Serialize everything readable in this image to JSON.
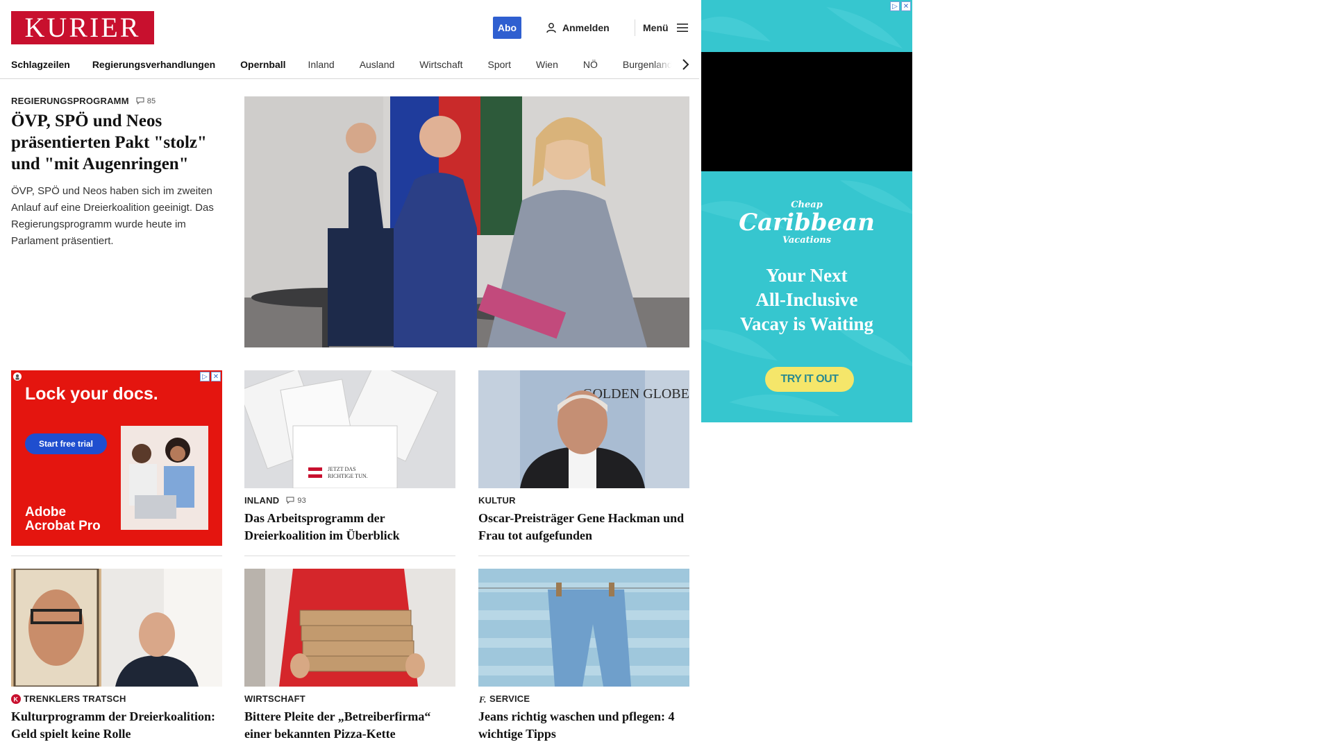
{
  "header": {
    "logo": "KURIER",
    "abo_label": "Abo",
    "login_label": "Anmelden",
    "menu_label": "Menü"
  },
  "nav": {
    "items": [
      "Schlagzeilen",
      "Regierungsverhandlungen",
      "Opernball",
      "Inland",
      "Ausland",
      "Wirtschaft",
      "Sport",
      "Wien",
      "NÖ",
      "Burgenland"
    ]
  },
  "lead": {
    "kicker": "REGIERUNGSPROGRAMM",
    "comments": "85",
    "title": "ÖVP, SPÖ und Neos präsentierten Pakt \"stolz\" und \"mit Augenringen\"",
    "teaser": "ÖVP, SPÖ und Neos haben sich im zweiten Anlauf auf eine Dreierkoalition geeinigt. Das Regierungsprogramm wurde heute im Parlament präsentiert."
  },
  "ad_left": {
    "title": "Lock your docs.",
    "cta": "Start free trial",
    "brand_line1": "Adobe",
    "brand_line2": "Acrobat Pro"
  },
  "cards": [
    {
      "kicker": "INLAND",
      "comments": "93",
      "title": "Das Arbeitsprogramm der Dreierkoalition im Überblick",
      "image_text_line1": "JETZT DAS",
      "image_text_line2": "RICHTIGE TUN."
    },
    {
      "kicker": "KULTUR",
      "title": "Oscar-Preisträger Gene Hackman und Frau tot aufgefunden",
      "image_text": "GOLDEN GLOBE"
    },
    {
      "kicker": "TRENKLERS TRATSCH",
      "title": "Kulturprogramm der Dreierkoalition: Geld spielt keine Rolle"
    },
    {
      "kicker": "WIRTSCHAFT",
      "title": "Bittere Pleite der „Betreiberfirma“ einer bekannten Pizza-Kette"
    },
    {
      "kicker": "SERVICE",
      "title": "Jeans richtig waschen und pflegen: 4 wichtige Tipps"
    }
  ],
  "ad_right": {
    "brand_top": "Cheap",
    "brand_main": "Caribbean",
    "brand_bottom": "Vacations",
    "headline_1": "Your Next",
    "headline_2": "All-Inclusive",
    "headline_3": "Vacay is Waiting",
    "cta": "TRY IT OUT"
  },
  "colors": {
    "brand_red": "#c8102e",
    "abo_blue": "#2f5fd0",
    "ad_teal": "#36c6cf"
  }
}
